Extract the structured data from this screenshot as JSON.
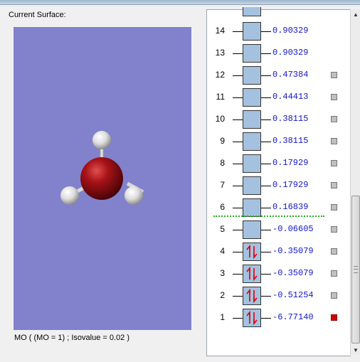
{
  "left_panel": {
    "surface_label": "Current Surface:",
    "caption": "MO ( (MO = 1) ; Isovalue = 0.02 )"
  },
  "colors": {
    "viewport_bg": "#8281cc",
    "orbital_box": "#a4c2e0",
    "energy_text": "#1414c8",
    "homo_lumo_line": "#1fb01f",
    "selected_marker": "#d80000",
    "oxygen": "#8b0b10",
    "hydrogen": "#e8e8e8"
  },
  "orbitals": [
    {
      "num": "14",
      "energy": "0.90329",
      "occupied": false,
      "selectable": false,
      "selected": false
    },
    {
      "num": "13",
      "energy": "0.90329",
      "occupied": false,
      "selectable": false,
      "selected": false
    },
    {
      "num": "12",
      "energy": "0.47384",
      "occupied": false,
      "selectable": true,
      "selected": false
    },
    {
      "num": "11",
      "energy": "0.44413",
      "occupied": false,
      "selectable": true,
      "selected": false
    },
    {
      "num": "10",
      "energy": "0.38115",
      "occupied": false,
      "selectable": true,
      "selected": false
    },
    {
      "num": "9",
      "energy": "0.38115",
      "occupied": false,
      "selectable": true,
      "selected": false
    },
    {
      "num": "8",
      "energy": "0.17929",
      "occupied": false,
      "selectable": true,
      "selected": false
    },
    {
      "num": "7",
      "energy": "0.17929",
      "occupied": false,
      "selectable": true,
      "selected": false
    },
    {
      "num": "6",
      "energy": "0.16839",
      "occupied": false,
      "selectable": true,
      "selected": false
    },
    {
      "num": "5",
      "energy": "-0.06605",
      "occupied": false,
      "selectable": true,
      "selected": false
    },
    {
      "num": "4",
      "energy": "-0.35079",
      "occupied": true,
      "selectable": true,
      "selected": false
    },
    {
      "num": "3",
      "energy": "-0.35079",
      "occupied": true,
      "selectable": true,
      "selected": false
    },
    {
      "num": "2",
      "energy": "-0.51254",
      "occupied": true,
      "selectable": true,
      "selected": false
    },
    {
      "num": "1",
      "energy": "-6.77140",
      "occupied": true,
      "selectable": true,
      "selected": true
    }
  ],
  "scrollbar": {
    "up_icon": "arrow-up-icon",
    "down_icon": "arrow-down-icon"
  }
}
